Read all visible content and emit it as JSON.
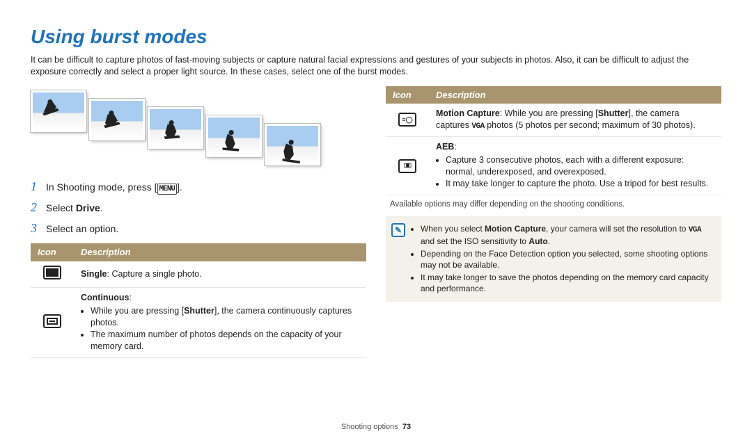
{
  "title": "Using burst modes",
  "intro": "It can be difficult to capture photos of fast-moving subjects or capture natural facial expressions and gestures of your subjects in photos. Also, it can be difficult to adjust the exposure correctly and select a proper light source. In these cases, select one of the burst modes.",
  "steps": {
    "s1_pre": "In Shooting mode, press [",
    "s1_glyph": "MENU",
    "s1_post": "].",
    "s2_pre": "Select ",
    "s2_bold": "Drive",
    "s2_post": ".",
    "s3": "Select an option."
  },
  "left_table": {
    "h_icon": "Icon",
    "h_desc": "Description",
    "single_bold": "Single",
    "single_rest": ": Capture a single photo.",
    "cont_bold": "Continuous",
    "cont_colon": ":",
    "cont_b1_pre": "While you are pressing [",
    "cont_b1_bold": "Shutter",
    "cont_b1_post": "], the camera continuously captures photos.",
    "cont_b2": "The maximum number of photos depends on the capacity of your memory card."
  },
  "right_table": {
    "h_icon": "Icon",
    "h_desc": "Description",
    "motion_bold": "Motion Capture",
    "motion_mid1": ": While you are pressing [",
    "motion_bold2": "Shutter",
    "motion_mid2": "], the camera captures ",
    "motion_vga": "VGA",
    "motion_mid3": " photos (5 photos per second; maximum of 30 photos).",
    "aeb_bold": "AEB",
    "aeb_colon": ":",
    "aeb_b1": "Capture 3 consecutive photos, each with a different exposure: normal, underexposed, and overexposed.",
    "aeb_b2": "It may take longer to capture the photo. Use a tripod for best results."
  },
  "footnote": "Available options may differ depending on the shooting conditions.",
  "notebox": {
    "b1_pre": "When you select ",
    "b1_bold": "Motion Capture",
    "b1_mid": ", your camera will set the resolution to ",
    "b1_vga": "VGA",
    "b1_post": " and set the ISO sensitivity to ",
    "b1_bold2": "Auto",
    "b1_end": ".",
    "b2": "Depending on the Face Detection option you selected, some shooting options may not be available.",
    "b3": "It may take longer to save the photos depending on the memory card capacity and performance."
  },
  "footer": {
    "section": "Shooting options",
    "page": "73"
  }
}
